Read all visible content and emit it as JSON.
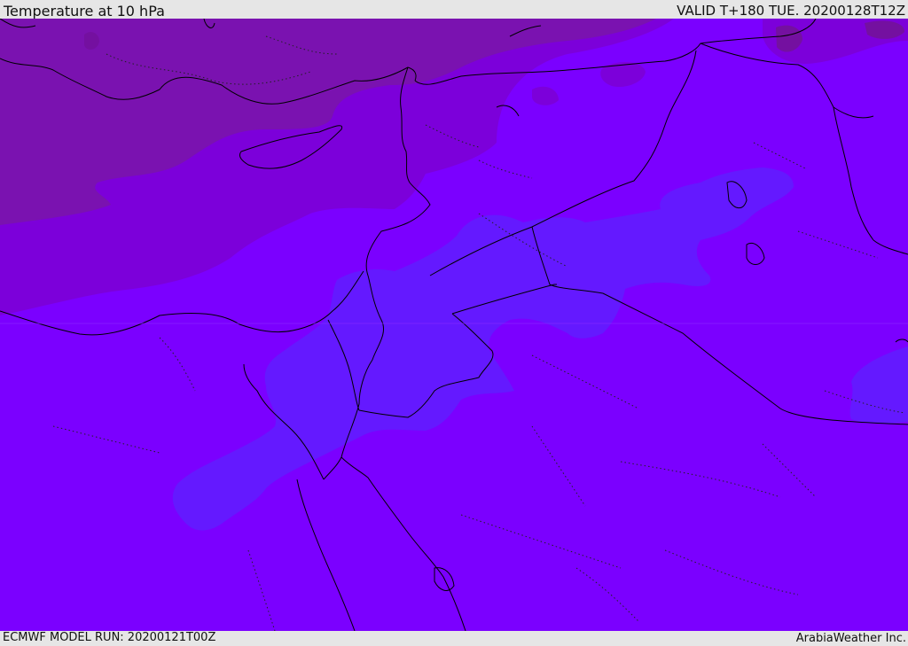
{
  "header": {
    "title": "Temperature at 10 hPa",
    "valid": "VALID T+180 TUE. 20200128T12Z"
  },
  "footer": {
    "model_run": "ECMWF MODEL RUN: 20200121T00Z",
    "credit": "ArabiaWeather Inc."
  },
  "colors": {
    "base": "#7b00ff",
    "warmer_zone": "#7c00da",
    "warmest_zone": "#7a12b0",
    "coldest_patch": "#6f2ac0",
    "cold_zone": "#6419ff",
    "coastline": "#000000"
  },
  "map": {
    "field": "temperature",
    "level": "10 hPa"
  }
}
